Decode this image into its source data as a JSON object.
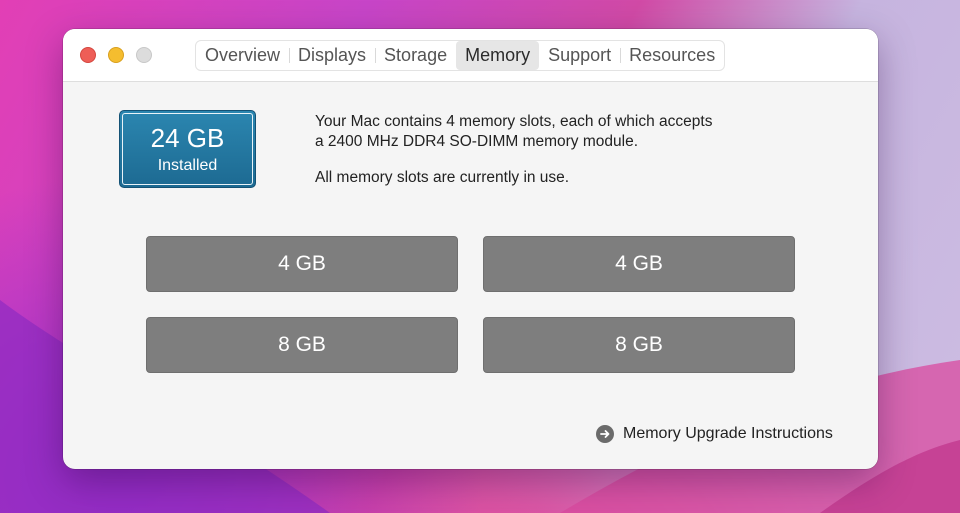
{
  "window": {
    "tabs": [
      {
        "label": "Overview",
        "active": false
      },
      {
        "label": "Displays",
        "active": false
      },
      {
        "label": "Storage",
        "active": false
      },
      {
        "label": "Memory",
        "active": true
      },
      {
        "label": "Support",
        "active": false
      },
      {
        "label": "Resources",
        "active": false
      }
    ]
  },
  "memory": {
    "installed": {
      "size": "24 GB",
      "label": "Installed",
      "color": "#2278a2"
    },
    "description_line1": "Your Mac contains 4 memory slots, each of which accepts",
    "description_line2": "a 2400 MHz DDR4 SO-DIMM memory module.",
    "status": "All memory slots are currently in use.",
    "slots": [
      "4 GB",
      "4 GB",
      "8 GB",
      "8 GB"
    ],
    "upgrade_link": {
      "label": "Memory Upgrade Instructions",
      "icon": "arrow-circle-right-icon"
    }
  },
  "colors": {
    "close": "#ee5e57",
    "minimize": "#f5bd2f",
    "zoom_inactive": "#dcdcdc",
    "slot": "#7e7e7e"
  }
}
